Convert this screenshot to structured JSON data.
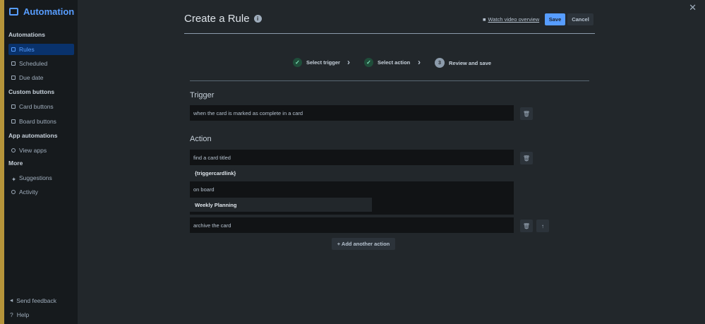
{
  "sidebar": {
    "title": "Automation",
    "sections": [
      {
        "label": "Automations"
      },
      {
        "label": "Custom buttons"
      },
      {
        "label": "App automations"
      },
      {
        "label": "More"
      }
    ],
    "items": [
      {
        "label": "Rules"
      },
      {
        "label": "Scheduled"
      },
      {
        "label": "Due date"
      },
      {
        "label": "Card buttons"
      },
      {
        "label": "Board buttons"
      },
      {
        "label": "View apps"
      },
      {
        "label": "Suggestions"
      },
      {
        "label": "Activity"
      }
    ],
    "footer": [
      {
        "label": "Send feedback"
      },
      {
        "label": "Help"
      }
    ]
  },
  "header": {
    "title": "Create a Rule",
    "video_link": "Watch video overview",
    "save": "Save",
    "cancel": "Cancel"
  },
  "steps": [
    {
      "label": "Select trigger",
      "state": "done"
    },
    {
      "label": "Select action",
      "state": "done"
    },
    {
      "label": "Review and save",
      "number": "3"
    }
  ],
  "trigger": {
    "heading": "Trigger",
    "text": "when the card is marked as complete in a card"
  },
  "action": {
    "heading": "Action",
    "find": "find a card titled",
    "title_value": "{triggercardlink}",
    "on_board": "on board",
    "board_value": "Weekly Planning",
    "archive": "archive the card",
    "add_label": "Add another action"
  }
}
